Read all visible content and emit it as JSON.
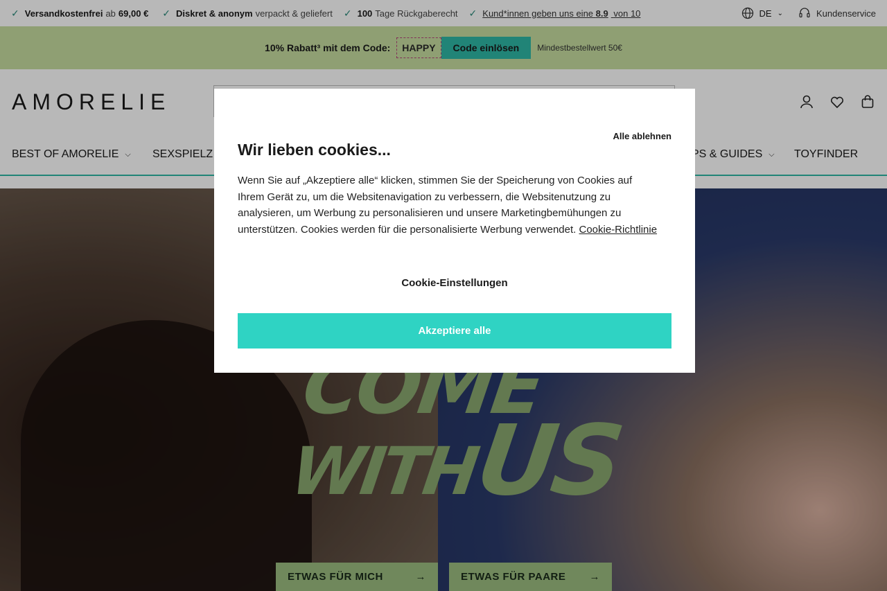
{
  "topbar": {
    "usps": [
      {
        "bold": "Versandkostenfrei",
        "text": "ab",
        "bold2": "69,00 €"
      },
      {
        "bold": "Diskret & anonym",
        "text": "verpackt & geliefert"
      },
      {
        "bold": "100",
        "text": "Tage Rückgaberecht"
      },
      {
        "link": "Kund*innen geben uns eine",
        "link_bold": "8.9",
        "link_end": "von 10"
      }
    ],
    "language": "DE",
    "support": "Kundenservice"
  },
  "promo": {
    "text": "10% Rabatt³ mit dem Code:",
    "code": "HAPPY",
    "button": "Code einlösen",
    "minimum": "Mindestbestellwert 50€"
  },
  "header": {
    "logo": "AMORELIE"
  },
  "nav": {
    "items": [
      {
        "label": "BEST OF AMORELIE"
      },
      {
        "label": "SEXSPIELZ"
      },
      {
        "label": "PS & GUIDES"
      },
      {
        "label": "TOYFINDER"
      }
    ]
  },
  "hero": {
    "line1": "COME",
    "line2": "WITH",
    "line3": "US",
    "cta1": "ETWAS FÜR MICH",
    "cta2": "ETWAS FÜR PAARE"
  },
  "cookie": {
    "decline": "Alle ablehnen",
    "title": "Wir lieben cookies...",
    "body": "Wenn Sie auf „Akzeptiere alle“ klicken, stimmen Sie der Speicherung von Cookies auf Ihrem Gerät zu, um die Websitenavigation zu verbessern, die Websitenutzung zu analysieren, um Werbung zu personalisieren und unsere Marketingbemühungen zu unterstützen. Cookies werden für die personalisierte Werbung verwendet.",
    "policy_link": "Cookie-Richtlinie",
    "settings": "Cookie-Einstellungen",
    "accept": "Akzeptiere alle"
  },
  "colors": {
    "accent": "#2fd3c3",
    "promo_bg": "#c6dda0",
    "hero_green": "#9bbd80"
  }
}
